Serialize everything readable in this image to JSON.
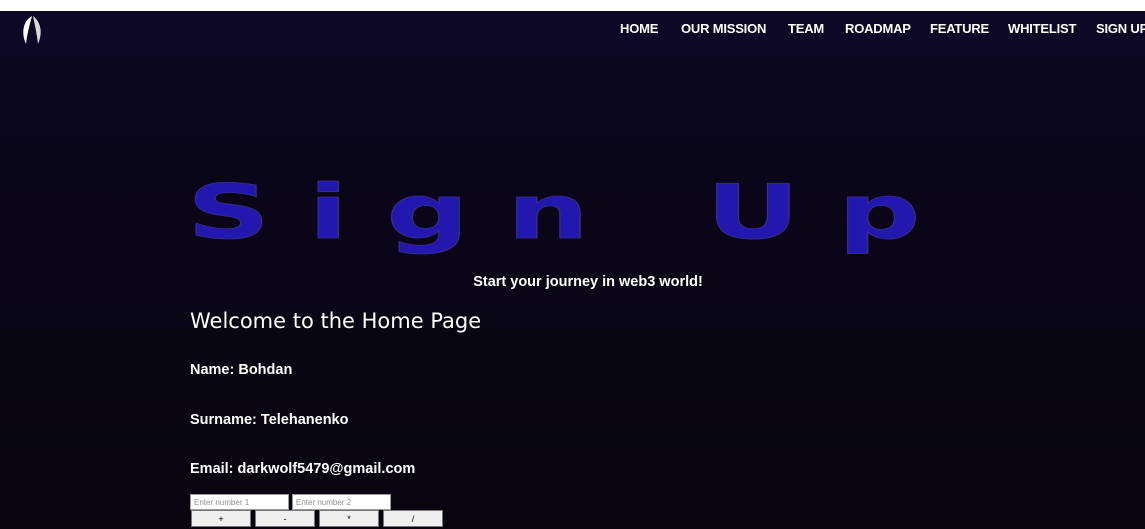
{
  "nav": {
    "logo_icon": "leaf-wing-logo-icon",
    "items": [
      {
        "label": "HOME"
      },
      {
        "label": "OUR MISSION"
      },
      {
        "label": "TEAM"
      },
      {
        "label": "ROADMAP"
      },
      {
        "label": "FEATURE"
      },
      {
        "label": "WHITELIST"
      },
      {
        "label": "SIGN UP"
      }
    ]
  },
  "hero": {
    "title": "Sign Up",
    "subtitle": "Start your journey in web3 world!"
  },
  "profile": {
    "heading": "Welcome to the Home Page",
    "name": "Name: Bohdan",
    "surname": "Surname: Telehanenko",
    "email": "Email: darkwolf5479@gmail.com"
  },
  "calculator": {
    "input1_placeholder": "Enter number 1",
    "input2_placeholder": "Enter number 2",
    "buttons": [
      {
        "label": "+"
      },
      {
        "label": "-"
      },
      {
        "label": "*"
      },
      {
        "label": "/"
      }
    ]
  },
  "colors": {
    "background": "#0a0720",
    "navbar": "#0c0826",
    "title_purple": "#2a1d6a",
    "title_blue": "#241a9e",
    "text": "#ffffff"
  }
}
